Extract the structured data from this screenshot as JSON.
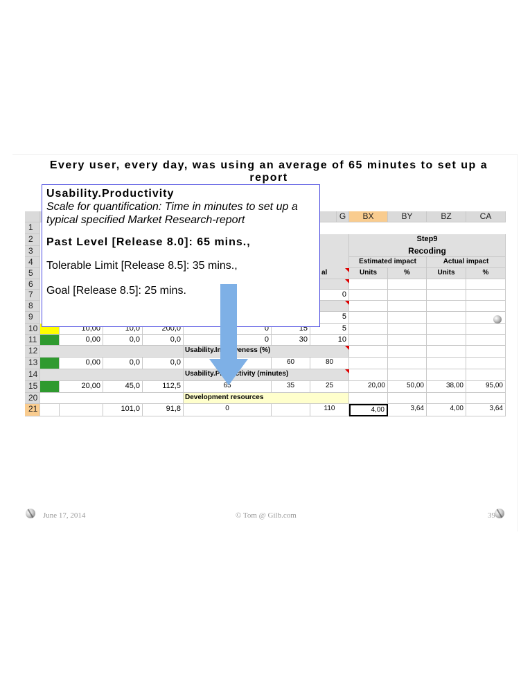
{
  "title": "Every user, every day, was using an average of 65 minutes to set up a report",
  "popup": {
    "heading": "Usability.Productivity",
    "scale": "Scale for quantification: Time in minutes to set up a typical specified Market Research-report",
    "past": "Past Level [Release 8.0]: 65 mins.,",
    "tolerable": "Tolerable Limit [Release 8.5]: 35 mins.,",
    "goal": "Goal [Release 8.5]: 25 mins."
  },
  "sheet": {
    "col_headers": [
      "G",
      "BX",
      "BY",
      "BZ",
      "CA"
    ],
    "row_numbers": [
      "1",
      "2",
      "3",
      "4",
      "5",
      "6",
      "7",
      "8",
      "9",
      "10",
      "11",
      "12",
      "13",
      "14",
      "15",
      "20",
      "21"
    ],
    "step_label": "Step9",
    "step_name": "Recoding",
    "estimated_impact": "Estimated impact",
    "actual_impact": "Actual impact",
    "units": "Units",
    "pct": "%",
    "partial_al": "al",
    "r7_g": "0",
    "r9_g": "5",
    "r10": [
      "10,00",
      "10,0",
      "200,0",
      "0",
      "15",
      "5"
    ],
    "r11": [
      "0,00",
      "0,0",
      "0,0",
      "0",
      "30",
      "10"
    ],
    "r12_label": "Usability.Intuitiveness (%)",
    "r13": [
      "0,00",
      "0,0",
      "0,0",
      "60",
      "80"
    ],
    "r14_label": "Usability.Productivity (minutes)",
    "r15": [
      "20,00",
      "45,0",
      "112,5",
      "65",
      "35",
      "25",
      "20,00",
      "50,00",
      "38,00",
      "95,00"
    ],
    "r20_label": "Development resources",
    "r21": [
      "101,0",
      "91,8",
      "0",
      "110",
      "4,00",
      "3,64",
      "4,00",
      "3,64"
    ]
  },
  "footer": {
    "date": "June 17, 2014",
    "copyright": "© Tom @ Gilb.com",
    "page": "39"
  },
  "colors": {
    "green_fill": "#2f9a2f",
    "yellow_fill": "#ffff00",
    "arrow": "#7eb0e6",
    "popup_border": "#4a4ae0",
    "selected_header": "#f9cc8f"
  }
}
